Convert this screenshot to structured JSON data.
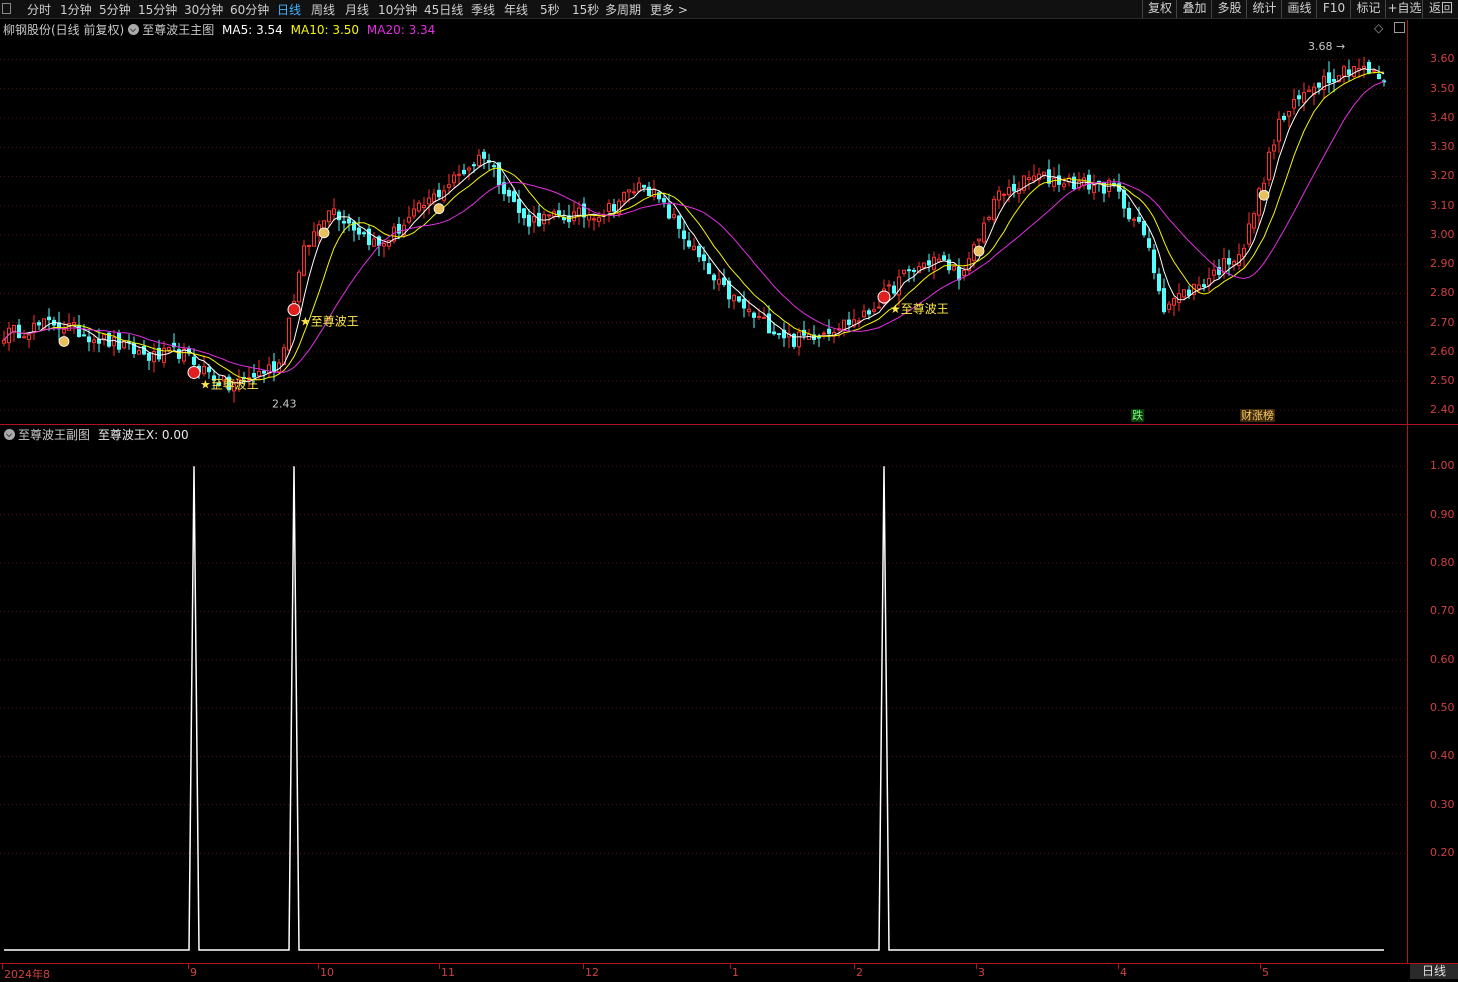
{
  "toolbar": {
    "tabs": [
      "分时",
      "1分钟",
      "5分钟",
      "15分钟",
      "30分钟",
      "60分钟",
      "日线",
      "周线",
      "月线",
      "10分钟",
      "45日线",
      "季线",
      "年线",
      "5秒",
      "15秒",
      "多周期",
      "更多 >"
    ],
    "active": "日线",
    "right_buttons": [
      "复权",
      "叠加",
      "多股",
      "统计",
      "画线",
      "F10",
      "标记",
      "+自选",
      "返回"
    ]
  },
  "main_header": {
    "stock": "柳钢股份(日线 前复权)",
    "indicator": "至尊波王主图",
    "ma5": "MA5: 3.54",
    "ma10": "MA10: 3.50",
    "ma20": "MA20: 3.34"
  },
  "sub_header": {
    "indicator": "至尊波王副图",
    "value": "至尊波王X: 0.00"
  },
  "annotations": {
    "signal_label": "至尊波王",
    "high_label": "3.68",
    "low_label": "2.43",
    "tag_drop": "跌",
    "tag_list": "财涨榜"
  },
  "chart_data": [
    {
      "type": "candlestick",
      "name": "main",
      "ylim": [
        2.36,
        3.68
      ],
      "yticks": [
        3.6,
        3.5,
        3.4,
        3.3,
        3.2,
        3.1,
        3.0,
        2.9,
        2.8,
        2.7,
        2.6,
        2.5,
        2.4
      ],
      "anchors": [
        [
          0,
          2.66
        ],
        [
          10,
          2.7
        ],
        [
          20,
          2.64
        ],
        [
          30,
          2.58
        ],
        [
          35,
          2.6
        ],
        [
          45,
          2.48
        ],
        [
          55,
          2.56
        ],
        [
          60,
          2.94
        ],
        [
          65,
          3.1
        ],
        [
          75,
          2.96
        ],
        [
          84,
          3.1
        ],
        [
          96,
          3.28
        ],
        [
          104,
          3.05
        ],
        [
          112,
          3.06
        ],
        [
          120,
          3.08
        ],
        [
          128,
          3.18
        ],
        [
          134,
          3.05
        ],
        [
          142,
          2.84
        ],
        [
          150,
          2.72
        ],
        [
          158,
          2.64
        ],
        [
          165,
          2.68
        ],
        [
          172,
          2.72
        ],
        [
          180,
          2.86
        ],
        [
          186,
          2.92
        ],
        [
          192,
          2.86
        ],
        [
          198,
          3.12
        ],
        [
          206,
          3.2
        ],
        [
          214,
          3.18
        ],
        [
          222,
          3.16
        ],
        [
          228,
          3.0
        ],
        [
          232,
          2.76
        ],
        [
          240,
          2.84
        ],
        [
          248,
          2.96
        ],
        [
          255,
          3.38
        ],
        [
          262,
          3.52
        ],
        [
          270,
          3.58
        ],
        [
          276,
          3.53
        ]
      ],
      "ma_labels": [
        "MA5",
        "MA10",
        "MA20"
      ],
      "ma_colors": [
        "#ffffff",
        "#f7f700",
        "#e030e0"
      ],
      "up_color": "#ff3030",
      "down_color": "#54ffff"
    },
    {
      "type": "line",
      "name": "至尊波王X",
      "ylim": [
        0,
        1.05
      ],
      "yticks": [
        1.0,
        0.9,
        0.8,
        0.7,
        0.6,
        0.5,
        0.4,
        0.3,
        0.2
      ],
      "spikes": [
        38,
        58,
        176
      ],
      "count": 277
    }
  ],
  "x_labels": [
    "2024年8",
    "9",
    "10",
    "11",
    "12",
    "1",
    "2",
    "3",
    "4",
    "5"
  ],
  "period": "日线"
}
